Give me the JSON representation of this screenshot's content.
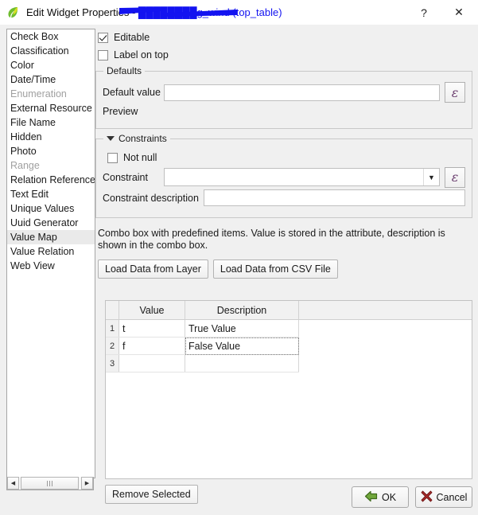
{
  "window": {
    "title_prefix": "Edit Widget Properties - ",
    "title_redacted": "████████g_wind (top_table)",
    "app_icon": "qgis-leaf-icon",
    "help_label": "?",
    "close_label": "✕"
  },
  "widget_list": {
    "items": [
      {
        "label": "Check Box",
        "disabled": false,
        "selected": false
      },
      {
        "label": "Classification",
        "disabled": false,
        "selected": false
      },
      {
        "label": "Color",
        "disabled": false,
        "selected": false
      },
      {
        "label": "Date/Time",
        "disabled": false,
        "selected": false
      },
      {
        "label": "Enumeration",
        "disabled": true,
        "selected": false
      },
      {
        "label": "External Resource",
        "disabled": false,
        "selected": false
      },
      {
        "label": "File Name",
        "disabled": false,
        "selected": false
      },
      {
        "label": "Hidden",
        "disabled": false,
        "selected": false
      },
      {
        "label": "Photo",
        "disabled": false,
        "selected": false
      },
      {
        "label": "Range",
        "disabled": true,
        "selected": false
      },
      {
        "label": "Relation Reference",
        "disabled": false,
        "selected": false
      },
      {
        "label": "Text Edit",
        "disabled": false,
        "selected": false
      },
      {
        "label": "Unique Values",
        "disabled": false,
        "selected": false
      },
      {
        "label": "Uuid Generator",
        "disabled": false,
        "selected": false
      },
      {
        "label": "Value Map",
        "disabled": false,
        "selected": true
      },
      {
        "label": "Value Relation",
        "disabled": false,
        "selected": false
      },
      {
        "label": "Web View",
        "disabled": false,
        "selected": false
      }
    ],
    "scroll_left_arrow": "◀",
    "scroll_right_arrow": "▶"
  },
  "options": {
    "editable_label": "Editable",
    "editable_checked": true,
    "label_on_top_label": "Label on top",
    "label_on_top_checked": false
  },
  "defaults": {
    "title": "Defaults",
    "default_value_label": "Default value",
    "default_value": "",
    "default_value_placeholder": "",
    "preview_label": "Preview",
    "expression_button": "ε"
  },
  "constraints": {
    "title": "Constraints",
    "expanded": true,
    "not_null_label": "Not null",
    "not_null_checked": false,
    "constraint_label": "Constraint",
    "constraint_value": "",
    "constraint_expression_button": "ε",
    "constraint_description_label": "Constraint description",
    "constraint_description_value": ""
  },
  "value_map": {
    "description": "Combo box with predefined items. Value is stored in the attribute, description is shown in the combo box.",
    "load_from_layer_label": "Load Data from Layer",
    "load_from_csv_label": "Load Data from CSV File",
    "columns": [
      "Value",
      "Description"
    ],
    "rows": [
      {
        "num": "1",
        "value": "t",
        "description": "True Value",
        "focused": false
      },
      {
        "num": "2",
        "value": "f",
        "description": "False Value",
        "focused": true
      },
      {
        "num": "3",
        "value": "",
        "description": "",
        "focused": false
      }
    ],
    "remove_selected_label": "Remove Selected"
  },
  "footer": {
    "ok_label": "OK",
    "cancel_label": "Cancel"
  },
  "colors": {
    "dialog_bg": "#f0f0f0",
    "selection": "#eaeaea",
    "expression_purple": "#6a3d6e",
    "ok_green": "#5a8a28",
    "cancel_red": "#a02828",
    "redaction_blue": "#1313f0"
  }
}
